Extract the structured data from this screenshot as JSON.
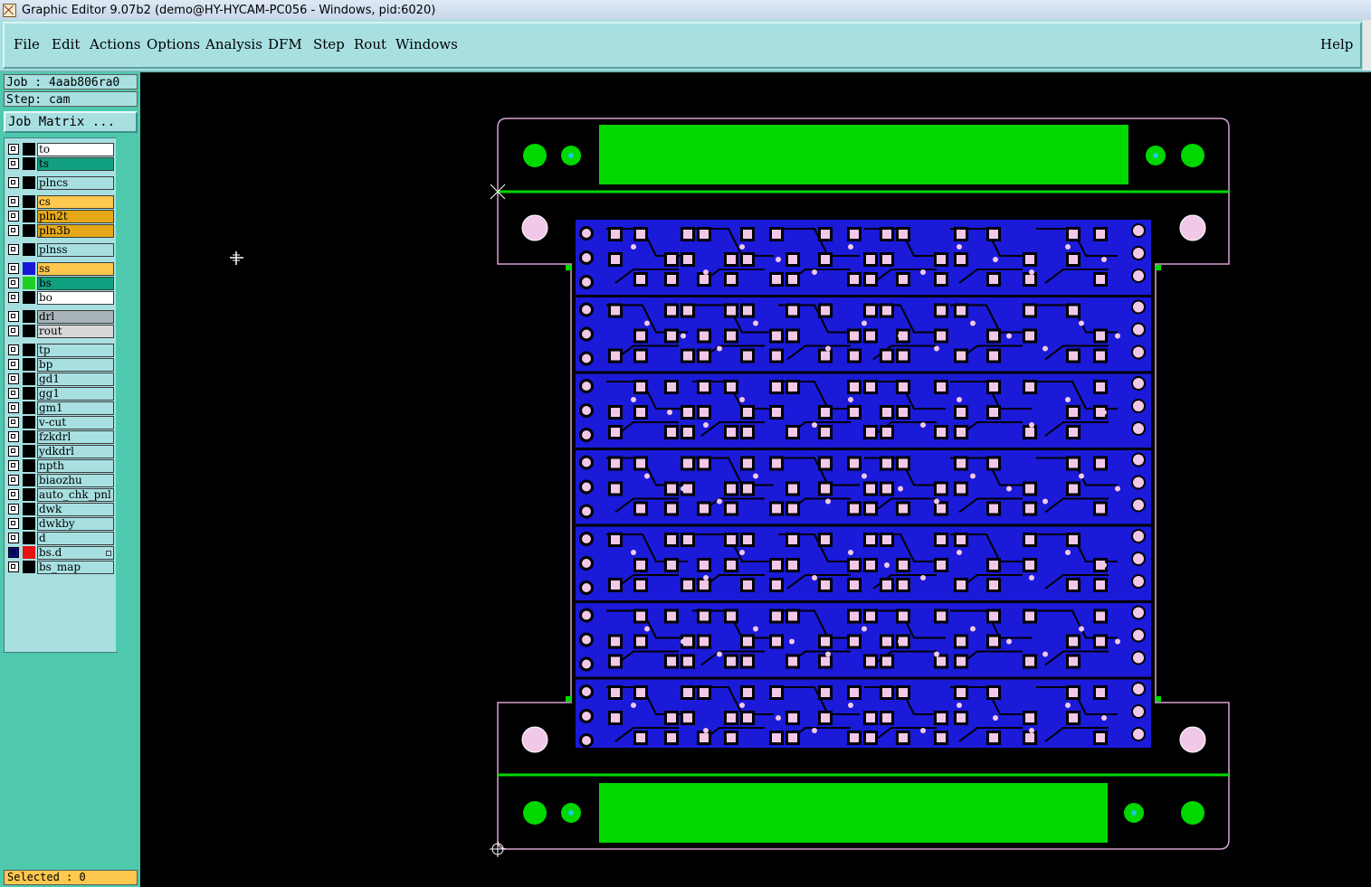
{
  "window": {
    "title": "Graphic Editor 9.07b2 (demo@HY-HYCAM-PC056 - Windows, pid:6020)"
  },
  "menu": {
    "items": [
      {
        "key": "file",
        "label": "File"
      },
      {
        "key": "edit",
        "label": "Edit"
      },
      {
        "key": "actions",
        "label": "Actions"
      },
      {
        "key": "options",
        "label": "Options"
      },
      {
        "key": "analysis",
        "label": "Analysis"
      },
      {
        "key": "dfm",
        "label": "DFM"
      },
      {
        "key": "step",
        "label": "Step"
      },
      {
        "key": "rout",
        "label": "Rout"
      },
      {
        "key": "windows",
        "label": "Windows"
      }
    ],
    "help": "Help"
  },
  "job": {
    "job_label": "Job : 4aab806ra0",
    "step_label": "Step: cam",
    "matrix_button": "Job Matrix ..."
  },
  "layers": [
    {
      "name": "to",
      "color": "#ffffff",
      "swatch": "#000000"
    },
    {
      "name": "ts",
      "color": "#10a080",
      "swatch": "#000000"
    },
    {
      "name": "plncs",
      "color": "#a8e0e2",
      "swatch": "#000000"
    },
    {
      "name": "cs",
      "color": "#ffc84e",
      "swatch": "#000000"
    },
    {
      "name": "pln2t",
      "color": "#e6a818",
      "swatch": "#000000"
    },
    {
      "name": "pln3b",
      "color": "#e6a818",
      "swatch": "#000000"
    },
    {
      "name": "plnss",
      "color": "#a8e0e2",
      "swatch": "#000000"
    },
    {
      "name": "ss",
      "color": "#ffc84e",
      "swatch": "#1818d8"
    },
    {
      "name": "bs",
      "color": "#10a080",
      "swatch": "#20d020"
    },
    {
      "name": "bo",
      "color": "#ffffff",
      "swatch": "#000000"
    },
    {
      "name": "drl",
      "color": "#a8b4b8",
      "swatch": "#000000"
    },
    {
      "name": "rout",
      "color": "#d8d8d8",
      "swatch": "#000000"
    },
    {
      "name": "tp",
      "color": "#a8e0e2",
      "swatch": "#000000"
    },
    {
      "name": "bp",
      "color": "#a8e0e2",
      "swatch": "#000000"
    },
    {
      "name": "gd1",
      "color": "#a8e0e2",
      "swatch": "#000000"
    },
    {
      "name": "gg1",
      "color": "#a8e0e2",
      "swatch": "#000000"
    },
    {
      "name": "gm1",
      "color": "#a8e0e2",
      "swatch": "#000000"
    },
    {
      "name": "v-cut",
      "color": "#a8e0e2",
      "swatch": "#000000"
    },
    {
      "name": "fzkdrl",
      "color": "#a8e0e2",
      "swatch": "#000000"
    },
    {
      "name": "ydkdrl",
      "color": "#a8e0e2",
      "swatch": "#000000"
    },
    {
      "name": "npth",
      "color": "#a8e0e2",
      "swatch": "#000000"
    },
    {
      "name": "biaozhu",
      "color": "#a8e0e2",
      "swatch": "#000000"
    },
    {
      "name": "auto_chk_pnl",
      "color": "#a8e0e2",
      "swatch": "#000000"
    },
    {
      "name": "dwk",
      "color": "#a8e0e2",
      "swatch": "#000000"
    },
    {
      "name": "dwkby",
      "color": "#a8e0e2",
      "swatch": "#000000"
    },
    {
      "name": "d",
      "color": "#a8e0e2",
      "swatch": "#000000"
    },
    {
      "name": "bs.d",
      "color": "#a8e0e2",
      "swatch": "#e81010",
      "checkbox_fill": "#0a0a90",
      "marker": true
    },
    {
      "name": "bs_map",
      "color": "#a8e0e2",
      "swatch": "#000000"
    }
  ],
  "status": {
    "selected": "Selected : 0"
  },
  "colors": {
    "menubar": "#a8e0e2",
    "panel": "#4ec9ad",
    "board_fill": "#1a1ad8",
    "frame_green": "#00d800",
    "pad_pink": "#f2c8e8",
    "outline_pink": "#d8a0d0",
    "hole_cyan": "#20c8d8"
  },
  "icons": {
    "app": "app-icon",
    "cursor": "crosshair-cursor-icon",
    "origin": "origin-marker-icon",
    "datum": "datum-x-icon"
  }
}
